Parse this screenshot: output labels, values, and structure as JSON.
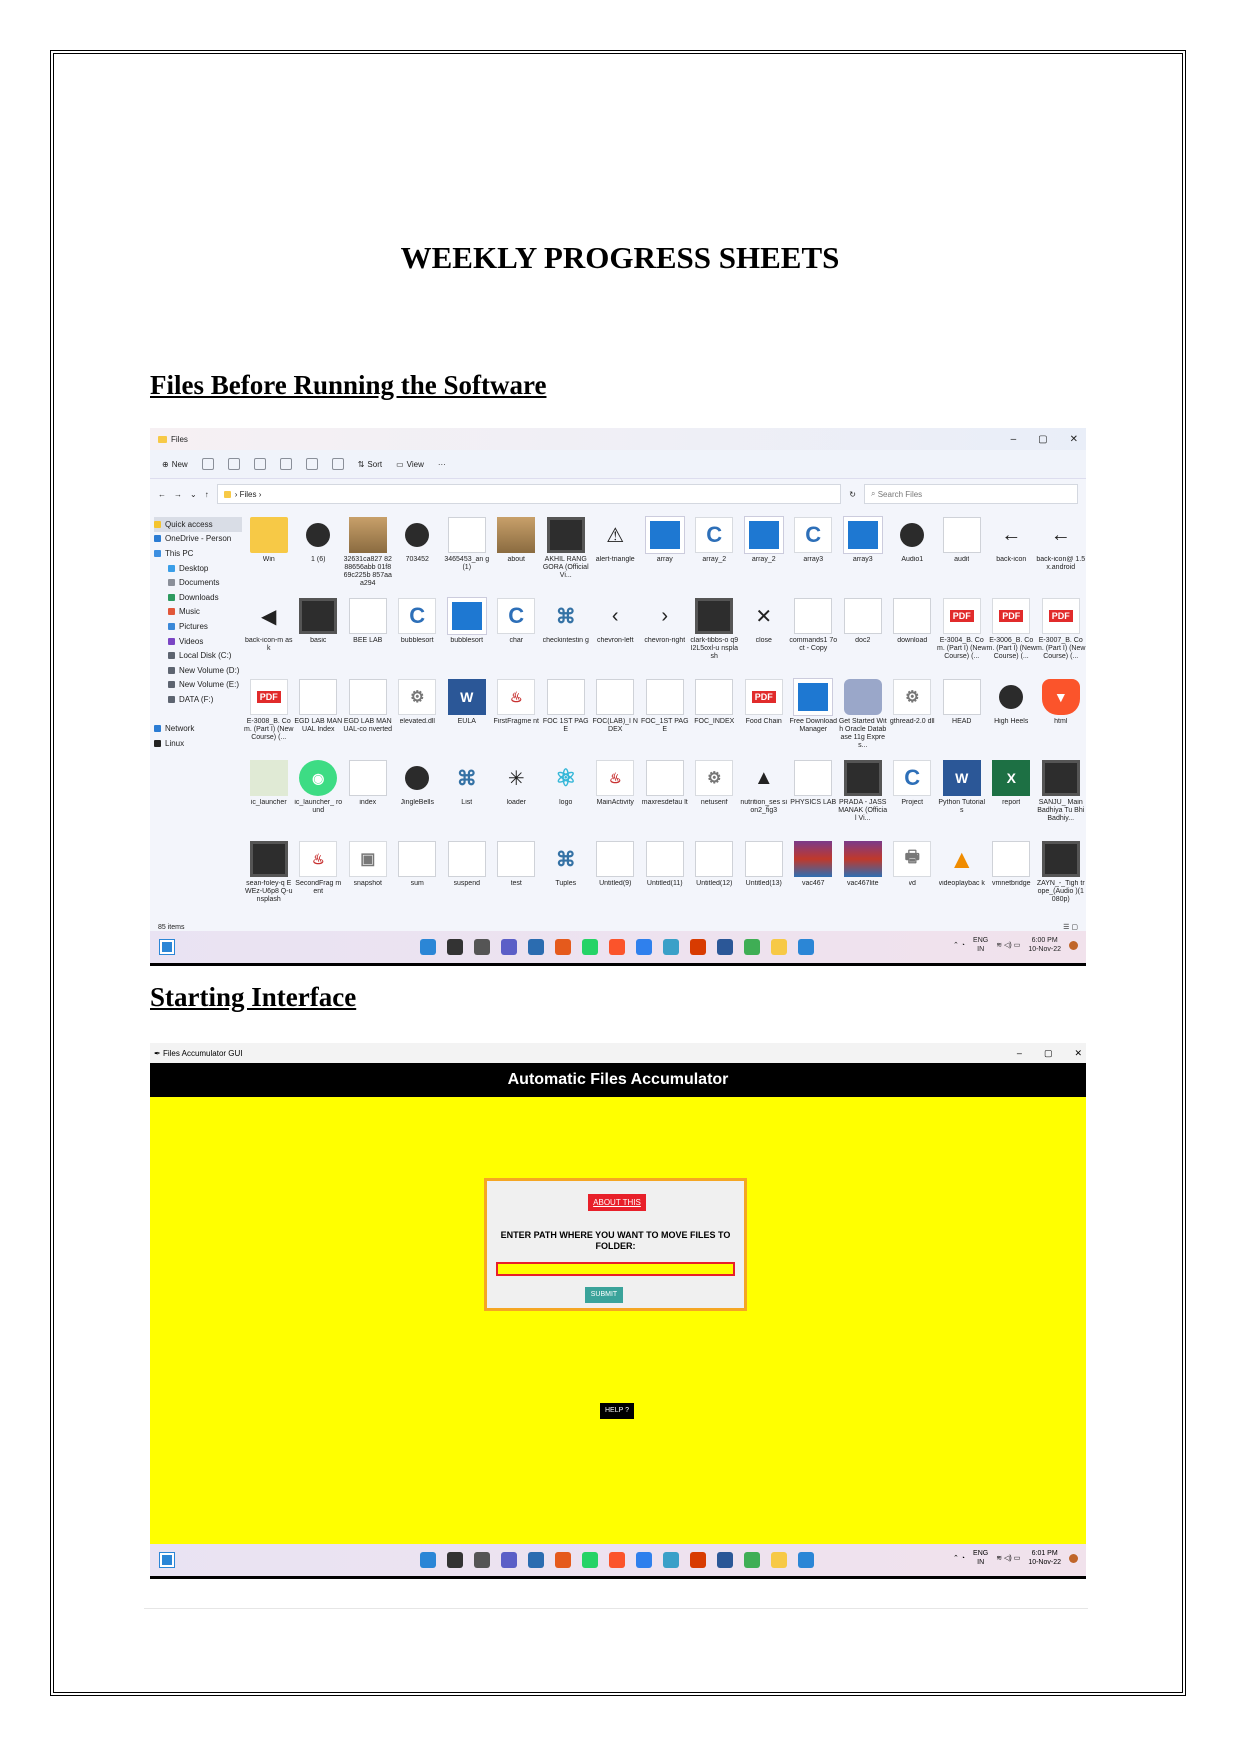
{
  "document": {
    "title": "WEEKLY PROGRESS SHEETS",
    "section1_heading": "Files Before Running the Software",
    "section2_heading": "Starting Interface"
  },
  "explorer": {
    "window_title": "Files",
    "toolbar": {
      "new": "New",
      "sort": "Sort",
      "view": "View",
      "more": "···"
    },
    "nav": {
      "back": "←",
      "forward": "→",
      "down": "⌄",
      "up": "↑",
      "refresh": "↻"
    },
    "breadcrumb": "›  Files  ›",
    "search_placeholder": "Search Files",
    "sidebar": [
      {
        "label": "Quick access",
        "color": "#f4c430",
        "indent": false,
        "selected": true
      },
      {
        "label": "OneDrive - Person",
        "color": "#2b7cd3",
        "indent": false,
        "selected": false
      },
      {
        "label": "This PC",
        "color": "#3c8ee0",
        "indent": false,
        "selected": false
      },
      {
        "label": "Desktop",
        "color": "#3a9ee8",
        "indent": true,
        "selected": false
      },
      {
        "label": "Documents",
        "color": "#8a8f99",
        "indent": true,
        "selected": false
      },
      {
        "label": "Downloads",
        "color": "#2d9a5f",
        "indent": true,
        "selected": false
      },
      {
        "label": "Music",
        "color": "#e1573a",
        "indent": true,
        "selected": false
      },
      {
        "label": "Pictures",
        "color": "#3a88d8",
        "indent": true,
        "selected": false
      },
      {
        "label": "Videos",
        "color": "#7a45c4",
        "indent": true,
        "selected": false
      },
      {
        "label": "Local Disk (C:)",
        "color": "#5d6470",
        "indent": true,
        "selected": false
      },
      {
        "label": "New Volume (D:)",
        "color": "#5d6470",
        "indent": true,
        "selected": false
      },
      {
        "label": "New Volume (E:)",
        "color": "#5d6470",
        "indent": true,
        "selected": false
      },
      {
        "label": "DATA (F:)",
        "color": "#5d6470",
        "indent": true,
        "selected": false
      },
      {
        "label": "",
        "color": "",
        "indent": false,
        "selected": false
      },
      {
        "label": "Network",
        "color": "#2b7cd3",
        "indent": false,
        "selected": false
      },
      {
        "label": "Linux",
        "color": "#222222",
        "indent": false,
        "selected": false
      }
    ],
    "files": [
      {
        "name": "Win",
        "type": "folder"
      },
      {
        "name": "1 (6)",
        "type": "play"
      },
      {
        "name": "32631ca827 8288656abb 01f869c225b 857aaa294",
        "type": "img"
      },
      {
        "name": "703452",
        "type": "play"
      },
      {
        "name": "3465453_an g (1)",
        "type": "doc"
      },
      {
        "name": "about",
        "type": "img"
      },
      {
        "name": "AKHIL RANG GORA (Official Vi...",
        "type": "video"
      },
      {
        "name": "alert-triangle",
        "type": "glyph",
        "glyph": "⚠"
      },
      {
        "name": "array",
        "type": "blue"
      },
      {
        "name": "array_2",
        "type": "c",
        "glyph": "C"
      },
      {
        "name": "array_2",
        "type": "blue"
      },
      {
        "name": "array3",
        "type": "c",
        "glyph": "C"
      },
      {
        "name": "array3",
        "type": "blue"
      },
      {
        "name": "Audio1",
        "type": "play"
      },
      {
        "name": "audit",
        "type": "doc"
      },
      {
        "name": "back-icon",
        "type": "glyph",
        "glyph": "←"
      },
      {
        "name": "back-icon@ 1.5x.android",
        "type": "glyph",
        "glyph": "←"
      },
      {
        "name": "back-icon-m ask",
        "type": "glyph",
        "glyph": "◀"
      },
      {
        "name": "basic",
        "type": "video"
      },
      {
        "name": "BEE LAB",
        "type": "doc"
      },
      {
        "name": "bubblesort",
        "type": "c",
        "glyph": "C"
      },
      {
        "name": "bubblesort",
        "type": "blue"
      },
      {
        "name": "char",
        "type": "c",
        "glyph": "C"
      },
      {
        "name": "checkintestin g",
        "type": "py",
        "glyph": "⌘"
      },
      {
        "name": "chevron-left",
        "type": "glyph",
        "glyph": "‹"
      },
      {
        "name": "chevron-right",
        "type": "glyph",
        "glyph": "›"
      },
      {
        "name": "clark-tibbs-o q9I2L5oxl-u nsplash",
        "type": "video"
      },
      {
        "name": "close",
        "type": "glyph",
        "glyph": "✕"
      },
      {
        "name": "commands1 7oct - Copy",
        "type": "doc"
      },
      {
        "name": "doc2",
        "type": "doc"
      },
      {
        "name": "download",
        "type": "doc"
      },
      {
        "name": "E-3004_B. Com. (Part I) (New Course) (...",
        "type": "pdf",
        "glyph": "PDF"
      },
      {
        "name": "E-3006_B. Com. (Part I) (New Course) (...",
        "type": "pdf",
        "glyph": "PDF"
      },
      {
        "name": "E-3007_B. Com. (Part I) (New Course) (...",
        "type": "pdf",
        "glyph": "PDF"
      },
      {
        "name": "E-3008_B. Com. (Part I) (New Course) (...",
        "type": "pdf",
        "glyph": "PDF"
      },
      {
        "name": "EGD LAB MANUAL Index",
        "type": "doc"
      },
      {
        "name": "EGD LAB MANUAL-co nverted",
        "type": "doc"
      },
      {
        "name": "elevated.dll",
        "type": "gear",
        "glyph": "⚙"
      },
      {
        "name": "EULA",
        "type": "word",
        "glyph": "W"
      },
      {
        "name": "FirstFragme nt",
        "type": "java",
        "glyph": "♨"
      },
      {
        "name": "FOC 1ST PAGE",
        "type": "doc"
      },
      {
        "name": "FOC(LAB)_I NDEX",
        "type": "doc"
      },
      {
        "name": "FOC_1ST PAGE",
        "type": "doc"
      },
      {
        "name": "FOC_INDEX",
        "type": "doc"
      },
      {
        "name": "Food Chain",
        "type": "pdf",
        "glyph": "PDF"
      },
      {
        "name": "Free Download Manager",
        "type": "blue"
      },
      {
        "name": "Get Started With Oracle Database 11g Expres...",
        "type": "db"
      },
      {
        "name": "gthread-2.0 dll",
        "type": "gear",
        "glyph": "⚙"
      },
      {
        "name": "HEAD",
        "type": "doc"
      },
      {
        "name": "High Heels",
        "type": "play"
      },
      {
        "name": "html",
        "type": "brave",
        "glyph": "▼"
      },
      {
        "name": "ic_launcher",
        "type": "green"
      },
      {
        "name": "ic_launcher_ round",
        "type": "android",
        "glyph": "◉"
      },
      {
        "name": "index",
        "type": "doc"
      },
      {
        "name": "JingleBells",
        "type": "play"
      },
      {
        "name": "List",
        "type": "py",
        "glyph": "⌘"
      },
      {
        "name": "loader",
        "type": "glyph",
        "glyph": "✳"
      },
      {
        "name": "logo",
        "type": "react",
        "glyph": "⚛"
      },
      {
        "name": "MainActivity",
        "type": "java",
        "glyph": "♨"
      },
      {
        "name": "maxresdefau lt",
        "type": "doc"
      },
      {
        "name": "netuserif",
        "type": "gear",
        "glyph": "⚙"
      },
      {
        "name": "nutrition_ses sion2_fig3",
        "type": "glyph",
        "glyph": "▲"
      },
      {
        "name": "PHYSICS LAB",
        "type": "doc"
      },
      {
        "name": "PRADA - JASS MANAK (Official Vi...",
        "type": "video"
      },
      {
        "name": "Project",
        "type": "c",
        "glyph": "C"
      },
      {
        "name": "Python Tutorials",
        "type": "word",
        "glyph": "W"
      },
      {
        "name": "report",
        "type": "excel",
        "glyph": "X"
      },
      {
        "name": "SANJU_ Main Badhiya Tu Bhi Badhiy...",
        "type": "video"
      },
      {
        "name": "sean-foley-q EWEz-U6p8 Q-unsplash",
        "type": "video"
      },
      {
        "name": "SecondFrag ment",
        "type": "java",
        "glyph": "♨"
      },
      {
        "name": "snapshot",
        "type": "gear",
        "glyph": "▣"
      },
      {
        "name": "sum",
        "type": "doc"
      },
      {
        "name": "suspend",
        "type": "doc"
      },
      {
        "name": "test",
        "type": "doc"
      },
      {
        "name": "Tuples",
        "type": "py",
        "glyph": "⌘"
      },
      {
        "name": "Untitled(9)",
        "type": "doc"
      },
      {
        "name": "Untitled(11)",
        "type": "doc"
      },
      {
        "name": "Untitled(12)",
        "type": "doc"
      },
      {
        "name": "Untitled(13)",
        "type": "doc"
      },
      {
        "name": "vac467",
        "type": "rar"
      },
      {
        "name": "vac467lite",
        "type": "rar"
      },
      {
        "name": "vd",
        "type": "gear",
        "glyph": "🖶"
      },
      {
        "name": "videoplaybac k",
        "type": "cone",
        "glyph": "▲"
      },
      {
        "name": "vmnetbridge",
        "type": "doc"
      },
      {
        "name": "ZAYN_-_Tigh trope_(Audio )(1080p)",
        "type": "video"
      }
    ],
    "status": "85 items",
    "taskbar": {
      "lang_top": "ENG",
      "lang_bottom": "IN",
      "time": "6:00 PM",
      "date": "10-Nov-22"
    }
  },
  "app": {
    "window_title": "Files Accumulator GUI",
    "header": "Automatic Files Accumulator",
    "about_button": "ABOUT THIS",
    "prompt": "ENTER PATH WHERE YOU WANT TO MOVE FILES TO FOLDER:",
    "path_value": "",
    "submit_button": "SUBMIT",
    "help_button": "HELP ?",
    "taskbar": {
      "lang_top": "ENG",
      "lang_bottom": "IN",
      "time": "6:01 PM",
      "date": "10-Nov-22"
    }
  },
  "taskbar_apps": [
    "#2b86d6",
    "#333333",
    "#555555",
    "#5b5fc7",
    "#2b6cb0",
    "#e55a1c",
    "#25d366",
    "#fb542b",
    "#2f80ed",
    "#3aa0c8",
    "#d83b01",
    "#2b5797",
    "#3fae55",
    "#f7c946",
    "#2b86d6"
  ]
}
